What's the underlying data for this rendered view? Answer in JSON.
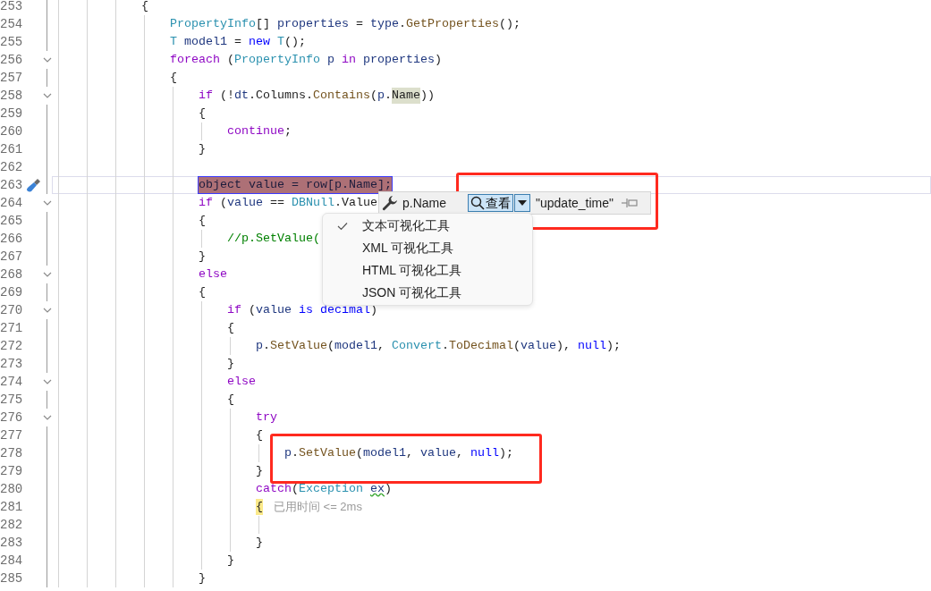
{
  "editor": {
    "lines": [
      {
        "number": "253",
        "foldable": false,
        "current": false,
        "tokens": [
          {
            "text": "{",
            "kind": "plain"
          }
        ],
        "children": [
          {
            "number": "254",
            "foldable": false,
            "current": false,
            "tokens": [
              {
                "text": "PropertyInfo",
                "kind": "type"
              },
              {
                "text": "[] ",
                "kind": "plain"
              },
              {
                "text": "properties",
                "kind": "var"
              },
              {
                "text": " = ",
                "kind": "plain"
              },
              {
                "text": "type",
                "kind": "var"
              },
              {
                "text": ".",
                "kind": "plain"
              },
              {
                "text": "GetProperties",
                "kind": "method"
              },
              {
                "text": "();",
                "kind": "plain"
              }
            ]
          },
          {
            "number": "255",
            "foldable": false,
            "current": false,
            "tokens": [
              {
                "text": "T ",
                "kind": "type"
              },
              {
                "text": "model1",
                "kind": "var"
              },
              {
                "text": " = ",
                "kind": "plain"
              },
              {
                "text": "new ",
                "kind": "kw"
              },
              {
                "text": "T",
                "kind": "type"
              },
              {
                "text": "();",
                "kind": "plain"
              }
            ]
          },
          {
            "number": "256",
            "foldable": true,
            "current": false,
            "tokens": [
              {
                "text": "foreach",
                "kind": "ctl"
              },
              {
                "text": " (",
                "kind": "plain"
              },
              {
                "text": "PropertyInfo ",
                "kind": "type"
              },
              {
                "text": "p ",
                "kind": "var"
              },
              {
                "text": "in ",
                "kind": "ctl"
              },
              {
                "text": "properties",
                "kind": "var"
              },
              {
                "text": ")",
                "kind": "plain"
              }
            ]
          },
          {
            "number": "257",
            "foldable": false,
            "current": false,
            "tokens": [
              {
                "text": "{",
                "kind": "plain"
              }
            ],
            "children": [
              {
                "number": "258",
                "foldable": true,
                "current": false,
                "tokens": [
                  {
                    "text": "if",
                    "kind": "ctl"
                  },
                  {
                    "text": " (!",
                    "kind": "plain"
                  },
                  {
                    "text": "dt",
                    "kind": "var"
                  },
                  {
                    "text": ".Columns.",
                    "kind": "plain"
                  },
                  {
                    "text": "Contains",
                    "kind": "method"
                  },
                  {
                    "text": "(",
                    "kind": "plain"
                  },
                  {
                    "text": "p",
                    "kind": "var"
                  },
                  {
                    "text": ".",
                    "kind": "plain"
                  },
                  {
                    "text": "Name",
                    "kind": "reference"
                  },
                  {
                    "text": "))",
                    "kind": "plain"
                  }
                ]
              },
              {
                "number": "259",
                "foldable": false,
                "current": false,
                "tokens": [
                  {
                    "text": "{",
                    "kind": "plain"
                  }
                ],
                "children": [
                  {
                    "number": "260",
                    "foldable": false,
                    "current": false,
                    "tokens": [
                      {
                        "text": "continue",
                        "kind": "ctl"
                      },
                      {
                        "text": ";",
                        "kind": "plain"
                      }
                    ]
                  }
                ]
              },
              {
                "number": "261",
                "foldable": false,
                "current": false,
                "tokens": [
                  {
                    "text": "}",
                    "kind": "plain"
                  }
                ]
              },
              {
                "number": "262",
                "foldable": false,
                "current": false
              },
              {
                "number": "263",
                "foldable": false,
                "current": true,
                "tokens": [
                  {
                    "text": "object value = row[p.Name];",
                    "kind": "selection"
                  }
                ]
              },
              {
                "number": "264",
                "foldable": true,
                "current": false,
                "tokens": [
                  {
                    "text": "if",
                    "kind": "ctl"
                  },
                  {
                    "text": " (",
                    "kind": "plain"
                  },
                  {
                    "text": "value",
                    "kind": "var"
                  },
                  {
                    "text": " == ",
                    "kind": "plain"
                  },
                  {
                    "text": "DBNull",
                    "kind": "type"
                  },
                  {
                    "text": ".Value",
                    "kind": "plain"
                  }
                ]
              },
              {
                "number": "265",
                "foldable": false,
                "current": false,
                "tokens": [
                  {
                    "text": "{",
                    "kind": "plain"
                  }
                ],
                "children": [
                  {
                    "number": "266",
                    "foldable": false,
                    "current": false,
                    "tokens": [
                      {
                        "text": "//p.SetValue(",
                        "kind": "comment"
                      }
                    ]
                  }
                ]
              },
              {
                "number": "267",
                "foldable": false,
                "current": false,
                "tokens": [
                  {
                    "text": "}",
                    "kind": "plain"
                  }
                ]
              },
              {
                "number": "268",
                "foldable": true,
                "current": false,
                "tokens": [
                  {
                    "text": "else",
                    "kind": "ctl"
                  }
                ]
              },
              {
                "number": "269",
                "foldable": false,
                "current": false,
                "tokens": [
                  {
                    "text": "{",
                    "kind": "plain"
                  }
                ],
                "children": [
                  {
                    "number": "270",
                    "foldable": true,
                    "current": false,
                    "tokens": [
                      {
                        "text": "if",
                        "kind": "ctl"
                      },
                      {
                        "text": " (",
                        "kind": "plain"
                      },
                      {
                        "text": "value ",
                        "kind": "var"
                      },
                      {
                        "text": "is decimal",
                        "kind": "kw"
                      },
                      {
                        "text": ")",
                        "kind": "plain"
                      }
                    ]
                  },
                  {
                    "number": "271",
                    "foldable": false,
                    "current": false,
                    "tokens": [
                      {
                        "text": "{",
                        "kind": "plain"
                      }
                    ],
                    "children": [
                      {
                        "number": "272",
                        "foldable": false,
                        "current": false,
                        "tokens": [
                          {
                            "text": "p",
                            "kind": "var"
                          },
                          {
                            "text": ".",
                            "kind": "plain"
                          },
                          {
                            "text": "SetValue",
                            "kind": "method"
                          },
                          {
                            "text": "(",
                            "kind": "plain"
                          },
                          {
                            "text": "model1",
                            "kind": "var"
                          },
                          {
                            "text": ", ",
                            "kind": "plain"
                          },
                          {
                            "text": "Convert",
                            "kind": "type"
                          },
                          {
                            "text": ".",
                            "kind": "plain"
                          },
                          {
                            "text": "ToDecimal",
                            "kind": "method"
                          },
                          {
                            "text": "(",
                            "kind": "plain"
                          },
                          {
                            "text": "value",
                            "kind": "var"
                          },
                          {
                            "text": "), ",
                            "kind": "plain"
                          },
                          {
                            "text": "null",
                            "kind": "kw"
                          },
                          {
                            "text": ");",
                            "kind": "plain"
                          }
                        ]
                      }
                    ]
                  },
                  {
                    "number": "273",
                    "foldable": false,
                    "current": false,
                    "tokens": [
                      {
                        "text": "}",
                        "kind": "plain"
                      }
                    ]
                  },
                  {
                    "number": "274",
                    "foldable": true,
                    "current": false,
                    "tokens": [
                      {
                        "text": "else",
                        "kind": "ctl"
                      }
                    ]
                  },
                  {
                    "number": "275",
                    "foldable": false,
                    "current": false,
                    "tokens": [
                      {
                        "text": "{",
                        "kind": "plain"
                      }
                    ],
                    "children": [
                      {
                        "number": "276",
                        "foldable": true,
                        "current": false,
                        "tokens": [
                          {
                            "text": "try",
                            "kind": "ctl"
                          }
                        ]
                      },
                      {
                        "number": "277",
                        "foldable": false,
                        "current": false,
                        "tokens": [
                          {
                            "text": "{",
                            "kind": "plain"
                          }
                        ],
                        "children": [
                          {
                            "number": "278",
                            "foldable": false,
                            "current": false,
                            "tokens": [
                              {
                                "text": "p",
                                "kind": "var"
                              },
                              {
                                "text": ".",
                                "kind": "plain"
                              },
                              {
                                "text": "SetValue",
                                "kind": "method"
                              },
                              {
                                "text": "(",
                                "kind": "plain"
                              },
                              {
                                "text": "model1",
                                "kind": "var"
                              },
                              {
                                "text": ", ",
                                "kind": "plain"
                              },
                              {
                                "text": "value",
                                "kind": "var"
                              },
                              {
                                "text": ", ",
                                "kind": "plain"
                              },
                              {
                                "text": "null",
                                "kind": "kw"
                              },
                              {
                                "text": ");",
                                "kind": "plain"
                              }
                            ]
                          }
                        ]
                      },
                      {
                        "number": "279",
                        "foldable": false,
                        "current": false,
                        "tokens": [
                          {
                            "text": "}",
                            "kind": "plain"
                          }
                        ]
                      },
                      {
                        "number": "280",
                        "foldable": false,
                        "current": false,
                        "tokens": [
                          {
                            "text": "catch",
                            "kind": "ctl"
                          },
                          {
                            "text": "(",
                            "kind": "plain"
                          },
                          {
                            "text": "Exception ",
                            "kind": "type"
                          },
                          {
                            "text": "ex",
                            "kind": "squiggle"
                          },
                          {
                            "text": ")",
                            "kind": "plain"
                          }
                        ]
                      },
                      {
                        "number": "281",
                        "foldable": false,
                        "current": false,
                        "tokens": [
                          {
                            "text": "{",
                            "kind": "brace"
                          },
                          {
                            "text": "已用时间 <= 2ms",
                            "kind": "hint"
                          }
                        ],
                        "children": [
                          {
                            "number": "282",
                            "foldable": false,
                            "current": false
                          }
                        ]
                      },
                      {
                        "number": "283",
                        "foldable": false,
                        "current": false,
                        "tokens": [
                          {
                            "text": "}",
                            "kind": "plain"
                          }
                        ]
                      }
                    ]
                  },
                  {
                    "number": "284",
                    "foldable": false,
                    "current": false,
                    "tokens": [
                      {
                        "text": "}",
                        "kind": "plain"
                      }
                    ]
                  }
                ]
              },
              {
                "number": "285",
                "foldable": false,
                "current": false,
                "tokens": [
                  {
                    "text": "}",
                    "kind": "plain"
                  }
                ]
              }
            ]
          }
        ]
      }
    ]
  },
  "data_tip": {
    "expression": "p.Name",
    "view_button": "查看",
    "value": "\"update_time\""
  },
  "visualizer_menu": {
    "items": [
      {
        "label": "文本可视化工具",
        "selected": true
      },
      {
        "label": "XML 可视化工具",
        "selected": false
      },
      {
        "label": "HTML 可视化工具",
        "selected": false
      },
      {
        "label": "JSON 可视化工具",
        "selected": false
      }
    ]
  }
}
